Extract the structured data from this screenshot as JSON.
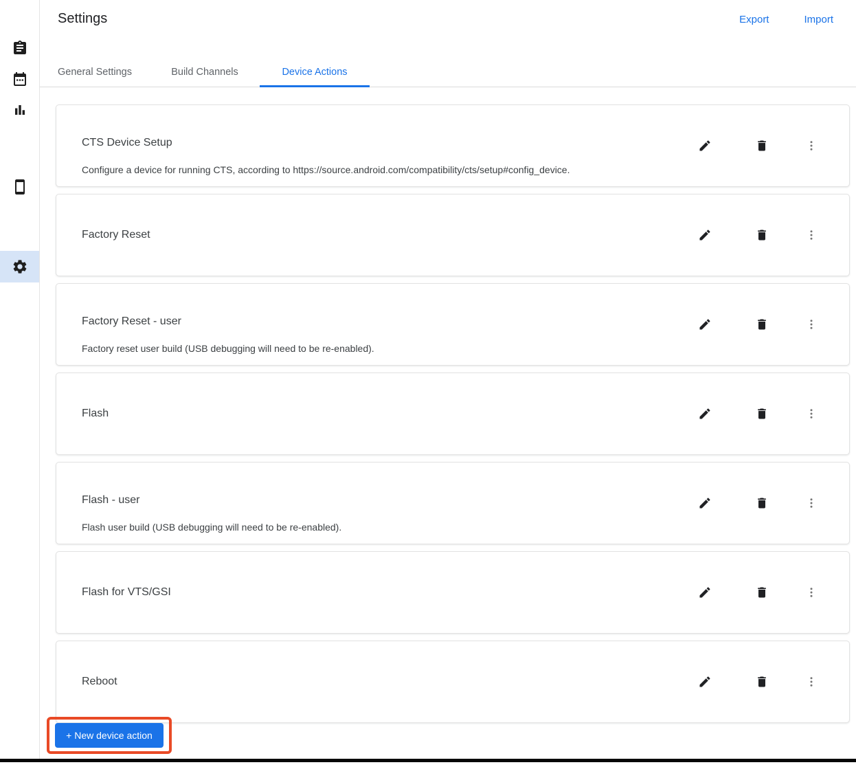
{
  "header": {
    "title": "Settings",
    "links": {
      "export": "Export",
      "import": "Import"
    }
  },
  "sidebar": {
    "items": [
      {
        "id": "tasks",
        "icon": "clipboard-icon",
        "active": false
      },
      {
        "id": "calendar",
        "icon": "calendar-icon",
        "active": false
      },
      {
        "id": "stats",
        "icon": "bar-chart-icon",
        "active": false
      },
      {
        "id": "devices",
        "icon": "smartphone-icon",
        "active": false
      },
      {
        "id": "settings",
        "icon": "gear-icon",
        "active": true
      }
    ]
  },
  "tabs": [
    {
      "label": "General Settings",
      "active": false
    },
    {
      "label": "Build Channels",
      "active": false
    },
    {
      "label": "Device Actions",
      "active": true
    }
  ],
  "cards": [
    {
      "title": "CTS Device Setup",
      "description": "Configure a device for running CTS, according to https://source.android.com/compatibility/cts/setup#config_device."
    },
    {
      "title": "Factory Reset",
      "description": ""
    },
    {
      "title": "Factory Reset - user",
      "description": "Factory reset user build (USB debugging will need to be re-enabled)."
    },
    {
      "title": "Flash",
      "description": ""
    },
    {
      "title": "Flash - user",
      "description": "Flash user build (USB debugging will need to be re-enabled)."
    },
    {
      "title": "Flash for VTS/GSI",
      "description": ""
    },
    {
      "title": "Reboot",
      "description": ""
    }
  ],
  "card_actions": {
    "edit": "edit",
    "delete": "delete",
    "more": "more"
  },
  "new_device_action_button": {
    "label": "+ New device action",
    "highlighted": true
  },
  "colors": {
    "accent_blue": "#1a73e8",
    "highlight_red": "#e94a26",
    "sidebar_selected_bg": "#d6e4f7"
  }
}
